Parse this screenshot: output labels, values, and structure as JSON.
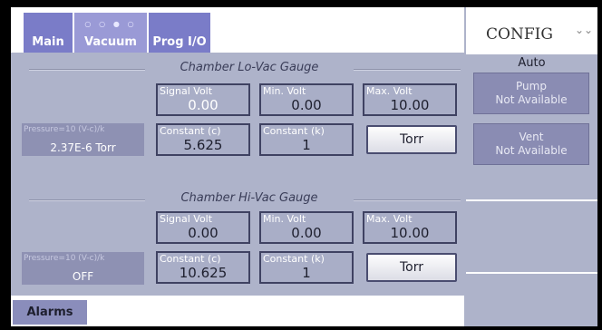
{
  "tabs": {
    "main": "Main",
    "vacuum": "Vacuum",
    "vacuum_dots": "○ ○ ● ○",
    "prog_io": "Prog I/O"
  },
  "lo_vac": {
    "title": "Chamber Lo-Vac Gauge",
    "signal_label": "Signal Volt",
    "signal_value": "0.00",
    "min_label": "Min. Volt",
    "min_value": "0.00",
    "max_label": "Max. Volt",
    "max_value": "10.00",
    "pressure_formula": "Pressure=10 (V-c)/k",
    "pressure_value": "2.37E-6 Torr",
    "c_label": "Constant (c)",
    "c_value": "5.625",
    "k_label": "Constant (k)",
    "k_value": "1",
    "unit_button": "Torr"
  },
  "hi_vac": {
    "title": "Chamber Hi-Vac Gauge",
    "signal_label": "Signal Volt",
    "signal_value": "0.00",
    "min_label": "Min. Volt",
    "min_value": "0.00",
    "max_label": "Max. Volt",
    "max_value": "10.00",
    "pressure_formula": "Pressure=10 (V-c)/k",
    "pressure_value": "OFF",
    "c_label": "Constant (c)",
    "c_value": "10.625",
    "k_label": "Constant (k)",
    "k_value": "1",
    "unit_button": "Torr"
  },
  "bottom": {
    "alarms": "Alarms"
  },
  "right": {
    "config": "CONFIG",
    "mode": "Auto",
    "pump_label": "Pump",
    "pump_status": "Not Available",
    "vent_label": "Vent",
    "vent_status": "Not Available"
  },
  "colors": {
    "tab": "#7a7cc8",
    "panel": "#aeb3ca",
    "box_border": "#3f4262"
  }
}
